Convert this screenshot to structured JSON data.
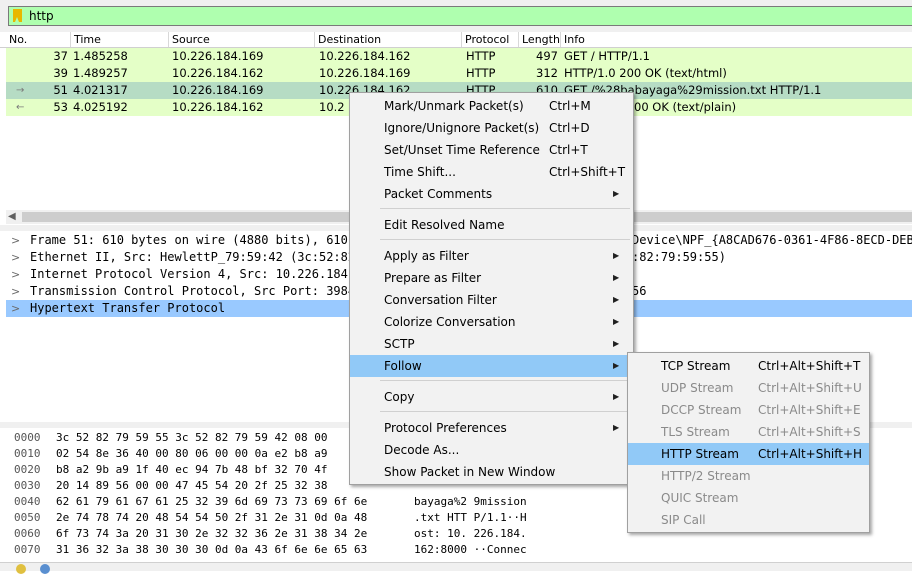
{
  "filter": {
    "text": "http"
  },
  "columns": {
    "no": "No.",
    "time": "Time",
    "source": "Source",
    "destination": "Destination",
    "protocol": "Protocol",
    "length": "Length",
    "info": "Info"
  },
  "packets": [
    {
      "no": "37",
      "time": "1.485258",
      "source": "10.226.184.169",
      "destination": "10.226.184.162",
      "protocol": "HTTP",
      "length": "497",
      "info": "GET / HTTP/1.1"
    },
    {
      "no": "39",
      "time": "1.489257",
      "source": "10.226.184.162",
      "destination": "10.226.184.169",
      "protocol": "HTTP",
      "length": "312",
      "info": "HTTP/1.0 200 OK  (text/html)"
    },
    {
      "no": "51",
      "time": "4.021317",
      "source": "10.226.184.169",
      "destination": "10.226.184.162",
      "protocol": "HTTP",
      "length": "610",
      "info": "GET /%28babayaga%29mission.txt HTTP/1.1"
    },
    {
      "no": "53",
      "time": "4.025192",
      "source": "10.226.184.162",
      "destination": "10.2",
      "protocol": "",
      "length": "",
      "info": "00 OK  (text/plain)"
    }
  ],
  "details": [
    {
      "left": "Frame 51: 610 bytes on wire (4880 bits), 610 b",
      "right": "Device\\NPF_{A8CAD676-0361-4F86-8ECD-DEB9"
    },
    {
      "left": "Ethernet II, Src: HewlettP_79:59:42 (3c:52:82:",
      "right": ":82:79:59:55)"
    },
    {
      "left": "Internet Protocol Version 4, Src: 10.226.184.1",
      "right": ""
    },
    {
      "left": "Transmission Control Protocol, Src Port: 39849",
      "right": "56"
    },
    {
      "left": "Hypertext Transfer Protocol",
      "right": ""
    }
  ],
  "bytes": [
    {
      "offset": "0000",
      "hex": "3c 52 82 79 59 55 3c 52  82 79 59 42 08 00",
      "ascii": ""
    },
    {
      "offset": "0010",
      "hex": "02 54 8e 36 40 00 80 06  00 00 0a e2 b8 a9",
      "ascii": ""
    },
    {
      "offset": "0020",
      "hex": "b8 a2 9b a9 1f 40 ec 94  7b 48 bf 32 70 4f",
      "ascii": ""
    },
    {
      "offset": "0030",
      "hex": "20 14 89 56 00 00 47 45  54 20 2f 25 32 38",
      "ascii": ""
    },
    {
      "offset": "0040",
      "hex": "62 61 79 61 67 61 25 32  39 6d 69 73 73 69 6f 6e",
      "ascii": "bayaga%2 9mission"
    },
    {
      "offset": "0050",
      "hex": "2e 74 78 74 20 48 54 54  50 2f 31 2e 31 0d 0a 48",
      "ascii": ".txt HTT P/1.1··H"
    },
    {
      "offset": "0060",
      "hex": "6f 73 74 3a 20 31 30 2e  32 32 36 2e 31 38 34 2e",
      "ascii": "ost: 10. 226.184."
    },
    {
      "offset": "0070",
      "hex": "31 36 32 3a 38 30 30 30  0d 0a 43 6f 6e 6e 65 63",
      "ascii": "162:8000 ··Connec"
    }
  ],
  "context_menu": {
    "items": [
      {
        "label": "Mark/Unmark Packet(s)",
        "shortcut": "Ctrl+M",
        "submenu": false
      },
      {
        "label": "Ignore/Unignore Packet(s)",
        "shortcut": "Ctrl+D",
        "submenu": false
      },
      {
        "label": "Set/Unset Time Reference",
        "shortcut": "Ctrl+T",
        "submenu": false
      },
      {
        "label": "Time Shift...",
        "shortcut": "Ctrl+Shift+T",
        "submenu": false
      },
      {
        "label": "Packet Comments",
        "shortcut": "",
        "submenu": true
      },
      {
        "label": "Edit Resolved Name",
        "shortcut": "",
        "submenu": false
      },
      {
        "label": "Apply as Filter",
        "shortcut": "",
        "submenu": true
      },
      {
        "label": "Prepare as Filter",
        "shortcut": "",
        "submenu": true
      },
      {
        "label": "Conversation Filter",
        "shortcut": "",
        "submenu": true
      },
      {
        "label": "Colorize Conversation",
        "shortcut": "",
        "submenu": true
      },
      {
        "label": "SCTP",
        "shortcut": "",
        "submenu": true
      },
      {
        "label": "Follow",
        "shortcut": "",
        "submenu": true
      },
      {
        "label": "Copy",
        "shortcut": "",
        "submenu": true
      },
      {
        "label": "Protocol Preferences",
        "shortcut": "",
        "submenu": true
      },
      {
        "label": "Decode As...",
        "shortcut": "",
        "submenu": false
      },
      {
        "label": "Show Packet in New Window",
        "shortcut": "",
        "submenu": false
      }
    ]
  },
  "follow_menu": {
    "items": [
      {
        "label": "TCP Stream",
        "shortcut": "Ctrl+Alt+Shift+T",
        "enabled": true
      },
      {
        "label": "UDP Stream",
        "shortcut": "Ctrl+Alt+Shift+U",
        "enabled": false
      },
      {
        "label": "DCCP Stream",
        "shortcut": "Ctrl+Alt+Shift+E",
        "enabled": false
      },
      {
        "label": "TLS Stream",
        "shortcut": "Ctrl+Alt+Shift+S",
        "enabled": false
      },
      {
        "label": "HTTP Stream",
        "shortcut": "Ctrl+Alt+Shift+H",
        "enabled": true
      },
      {
        "label": "HTTP/2 Stream",
        "shortcut": "",
        "enabled": false
      },
      {
        "label": "QUIC Stream",
        "shortcut": "",
        "enabled": false
      },
      {
        "label": "SIP Call",
        "shortcut": "",
        "enabled": false
      }
    ]
  }
}
